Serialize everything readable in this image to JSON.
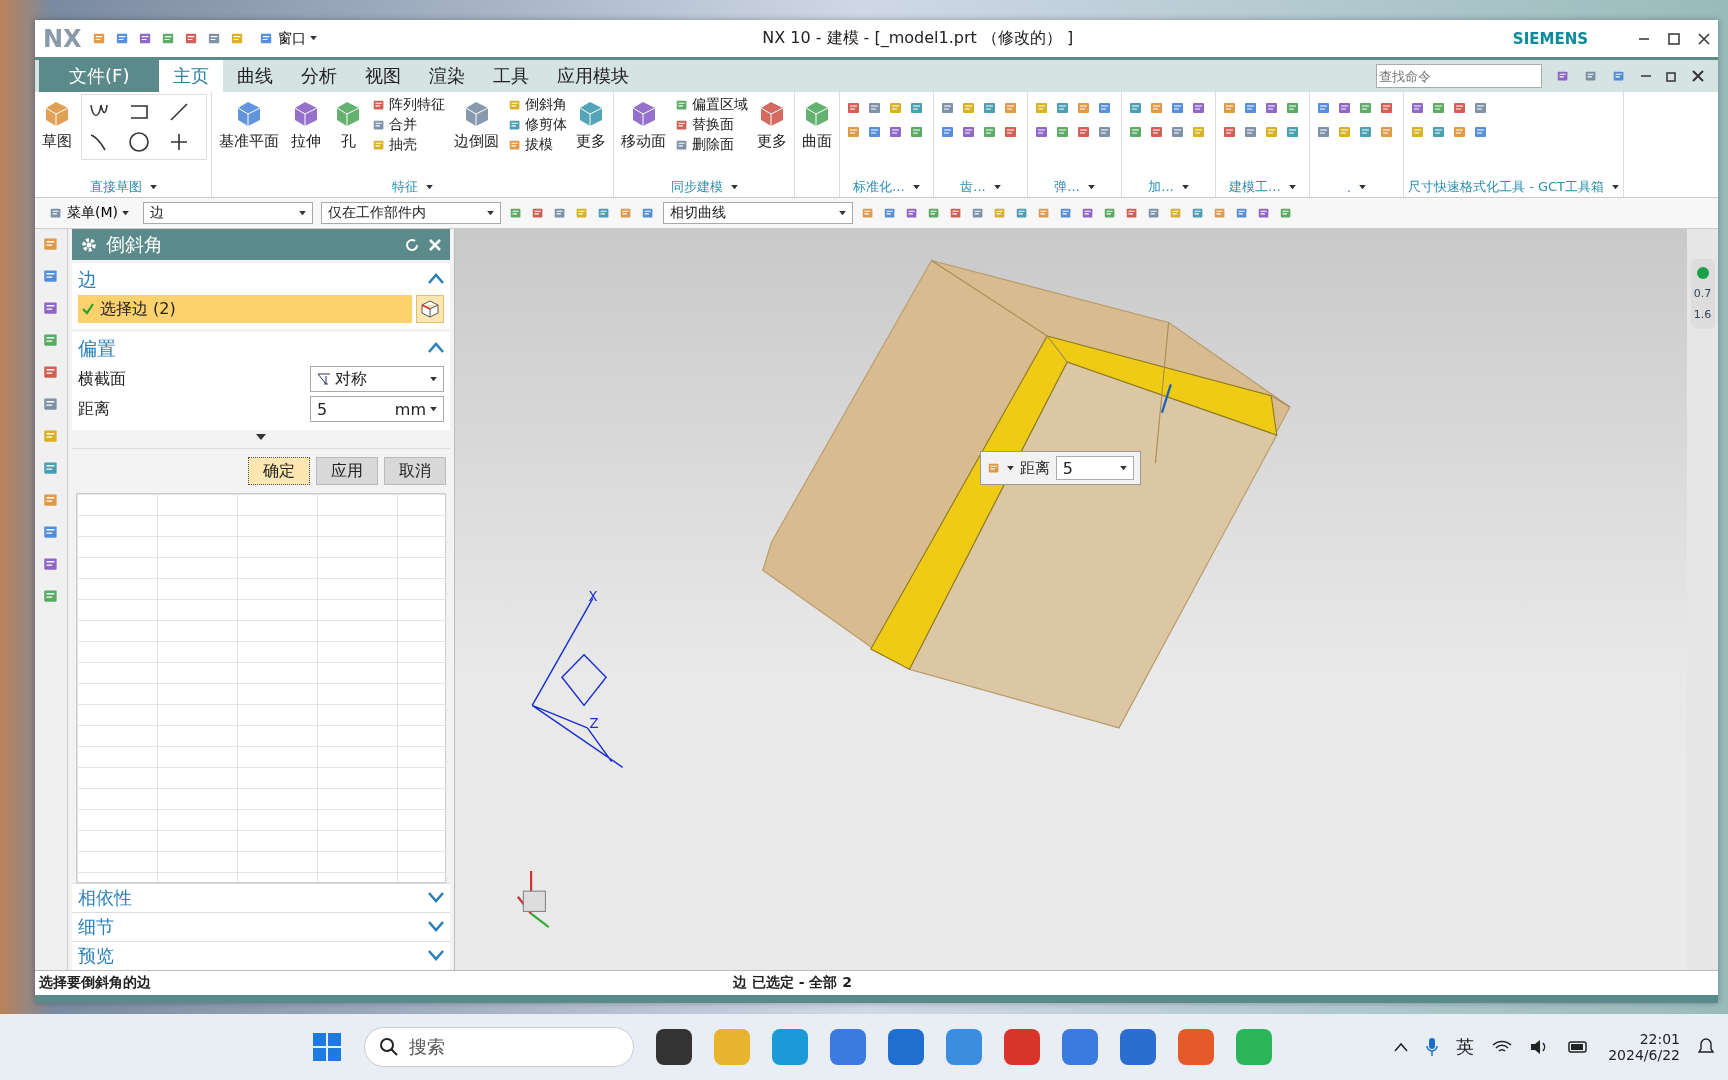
{
  "window": {
    "logo": "NX",
    "title": "NX 10 - 建模 - [_model1.prt （修改的） ]",
    "brand": "SIEMENS",
    "window_menu": "窗口"
  },
  "menu_tabs": [
    {
      "label": "文件(F)",
      "kind": "file",
      "selected": false
    },
    {
      "label": "主页",
      "kind": "tab",
      "selected": true
    },
    {
      "label": "曲线",
      "kind": "tab",
      "selected": false
    },
    {
      "label": "分析",
      "kind": "tab",
      "selected": false
    },
    {
      "label": "视图",
      "kind": "tab",
      "selected": false
    },
    {
      "label": "渲染",
      "kind": "tab",
      "selected": false
    },
    {
      "label": "工具",
      "kind": "tab",
      "selected": false
    },
    {
      "label": "应用模块",
      "kind": "tab",
      "selected": false
    }
  ],
  "command_search": {
    "placeholder": "查找命令"
  },
  "ribbon_groups": [
    {
      "label": "直接草图",
      "kind": "sketch",
      "items": [
        {
          "kind": "big",
          "label": "草图"
        }
      ]
    },
    {
      "label": "特征",
      "kind": "commands",
      "items": [
        {
          "kind": "big",
          "label": "基准平面"
        },
        {
          "kind": "big",
          "label": "拉伸"
        },
        {
          "kind": "big",
          "label": "孔"
        },
        {
          "kind": "stack",
          "entries": [
            "阵列特征",
            "合并",
            "抽壳"
          ]
        },
        {
          "kind": "big",
          "label": "边倒圆"
        },
        {
          "kind": "stack",
          "entries": [
            "倒斜角",
            "修剪体",
            "拔模"
          ]
        },
        {
          "kind": "big",
          "label": "更多"
        }
      ]
    },
    {
      "label": "同步建模",
      "kind": "commands",
      "items": [
        {
          "kind": "big",
          "label": "移动面"
        },
        {
          "kind": "stack",
          "entries": [
            "偏置区域",
            "替换面",
            "删除面"
          ]
        },
        {
          "kind": "big",
          "label": "更多"
        }
      ]
    },
    {
      "kind": "commands",
      "items": [
        {
          "kind": "big",
          "label": "曲面"
        }
      ]
    },
    {
      "label": "标准化...",
      "kind": "icons"
    },
    {
      "label": "齿...",
      "kind": "icons"
    },
    {
      "label": "弹...",
      "kind": "icons"
    },
    {
      "label": "加...",
      "kind": "icons"
    },
    {
      "label": "建模工...",
      "kind": "icons"
    },
    {
      "label": ".",
      "kind": "icons"
    },
    {
      "label": "尺寸快速格式化工具 - GCT工具箱",
      "kind": "icons"
    }
  ],
  "selection_bar": {
    "menu": "菜单(M)",
    "type_filter": "边",
    "scope": "仅在工作部件内",
    "curve_rule": "相切曲线"
  },
  "dialog": {
    "title": "倒斜角",
    "sections": [
      {
        "title": "边",
        "expanded": true,
        "kind": "selection",
        "select_label": "选择边 (2)",
        "complete": true
      },
      {
        "title": "偏置",
        "expanded": true,
        "kind": "fields",
        "fields": [
          {
            "label": "横截面",
            "value": "对称",
            "kind": "dropdown"
          },
          {
            "label": "距离",
            "value": "5",
            "unit": "mm",
            "kind": "unit"
          }
        ]
      }
    ],
    "buttons": [
      {
        "label": "确定",
        "kind": "default"
      },
      {
        "label": "应用",
        "kind": "normal"
      },
      {
        "label": "取消",
        "kind": "normal"
      }
    ],
    "collapsed_sections": [
      {
        "title": "相依性",
        "expanded": false
      },
      {
        "title": "细节",
        "expanded": false
      },
      {
        "title": "预览",
        "expanded": false
      }
    ]
  },
  "viewport": {
    "onscreen_input": {
      "label": "距离",
      "value": "5"
    },
    "axis_labels": [
      "X",
      "Z"
    ],
    "net_speeds": [
      "0.7",
      "1.6"
    ]
  },
  "status_bar": {
    "prompt": "选择要倒斜角的边",
    "selection": "边 已选定 - 全部 2"
  },
  "taskbar": {
    "search": {
      "placeholder": "搜索"
    },
    "ime": "英",
    "time": "22:01",
    "date": "2024/6/22"
  }
}
